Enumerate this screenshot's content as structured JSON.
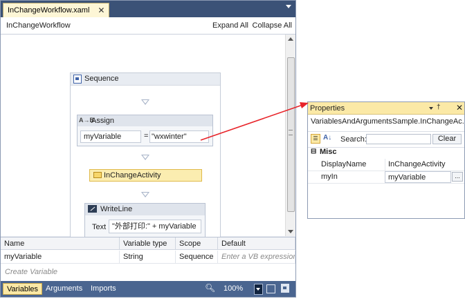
{
  "designer": {
    "tab_title": "InChangeWorkflow.xaml",
    "breadcrumb": "InChangeWorkflow",
    "expand_all": "Expand All",
    "collapse_all": "Collapse All",
    "sequence": {
      "title": "Sequence"
    },
    "assign": {
      "icon_text": "A→B",
      "title": "Assign",
      "to": "myVariable",
      "eq": "=",
      "value": "\"wxwinter\""
    },
    "inchange": {
      "title": "InChangeActivity"
    },
    "writeline": {
      "title": "WriteLine",
      "text_label": "Text",
      "text_value": "\"外部打印:\" + myVariable"
    }
  },
  "variables": {
    "columns": [
      "Name",
      "Variable type",
      "Scope",
      "Default"
    ],
    "rows": [
      {
        "name": "myVariable",
        "type": "String",
        "scope": "Sequence",
        "default": "Enter a VB expression"
      }
    ],
    "create_label": "Create Variable"
  },
  "bottom_bar": {
    "tabs": [
      "Variables",
      "Arguments",
      "Imports"
    ],
    "zoom": "100%"
  },
  "properties": {
    "title": "Properties",
    "type_name": "VariablesAndArgumentsSample.InChangeAc...",
    "search_label": "Search:",
    "clear": "Clear",
    "category": "Misc",
    "rows": [
      {
        "name": "DisplayName",
        "value": "InChangeActivity"
      },
      {
        "name": "myIn",
        "value": "myVariable"
      }
    ],
    "ellipsis": "..."
  },
  "colors": {
    "tab_strip": "#3b5277",
    "active_tab": "#fdf6d6",
    "selected_activity": "#fbedb0",
    "arrow": "#e8242a"
  },
  "icons": [
    "close-icon",
    "dropdown-icon",
    "sequence-icon",
    "assign-icon",
    "activity-icon",
    "writeline-icon",
    "search-icon",
    "pin-icon",
    "categorized-icon",
    "alphabetical-icon",
    "collapse-icon"
  ]
}
